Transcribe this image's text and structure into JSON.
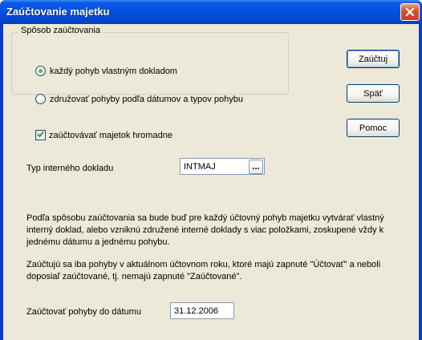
{
  "window": {
    "title": "Zaúčtovanie majetku"
  },
  "group": {
    "legend": "Spôsob zaúčtovania",
    "options": [
      {
        "label": "každý pohyb vlastným dokladom",
        "selected": true
      },
      {
        "label": "združovať pohyby podľa dátumov a typov pohybu",
        "selected": false
      }
    ]
  },
  "checkbox": {
    "label": "zaúčtovávať majetok hromadne",
    "checked": true
  },
  "doc_type": {
    "label": "Typ interného dokladu",
    "value": "INTMAJ",
    "browse_label": "..."
  },
  "buttons": {
    "post": "Zaúčtuj",
    "back": "Späť",
    "help": "Pomoc"
  },
  "info": {
    "paragraph1": "Podľa spôsobu zaúčtovania sa bude buď pre každý účtovný pohyb majetku vytvárať vlastný interný doklad, alebo vzniknú združené interné doklady s viac položkami, zoskupené vždy k jednému dátumu a jednému pohybu.",
    "paragraph2": "Zaúčtujú sa iba pohyby v aktuálnom účtovnom roku, ktoré majú zapnuté \"Účtovať\" a neboli doposiaľ zaúčtované, tj. nemajú zapnuté \"Zaúčtované\"."
  },
  "date": {
    "label": "Zaúčtovať pohyby do dátumu",
    "value": "31.12.2006"
  },
  "colors": {
    "titlebar": "#0651dd",
    "client": "#ece9d8",
    "close_button": "#d8572f",
    "radio_check": "#21a121"
  },
  "icons": {
    "close": "close-icon",
    "check": "check-icon"
  }
}
